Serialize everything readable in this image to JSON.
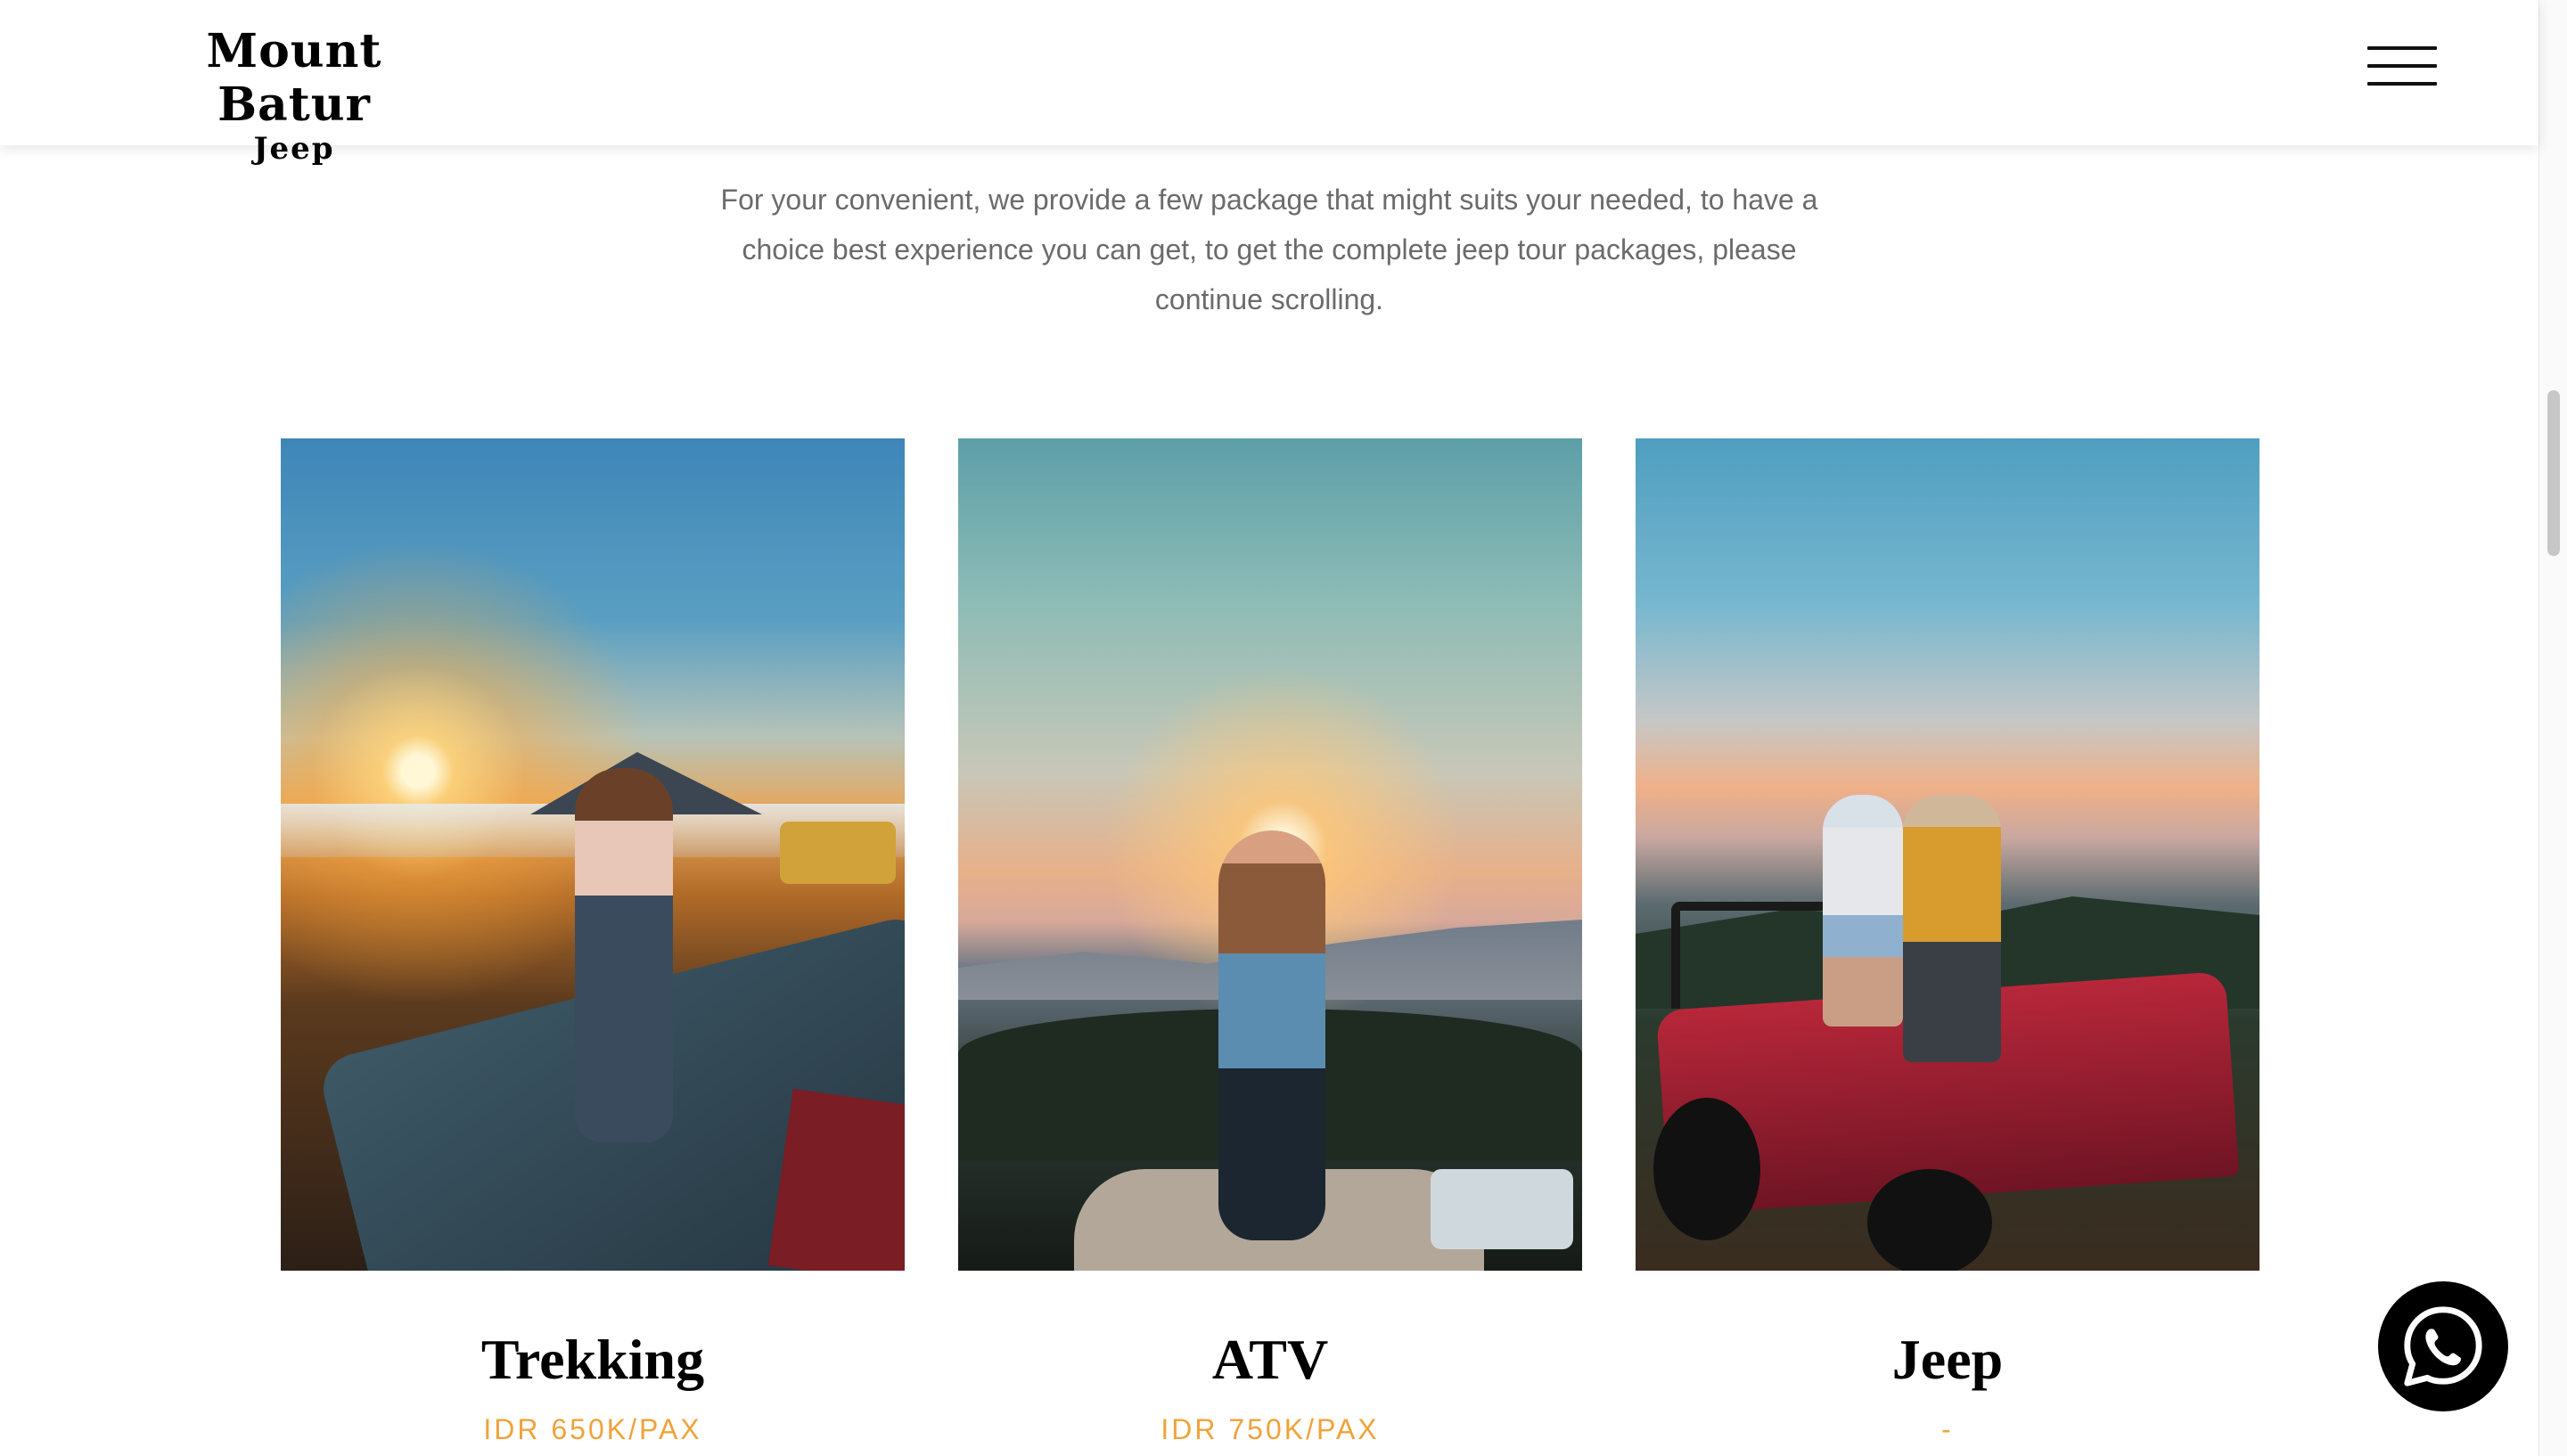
{
  "header": {
    "logo_title": "Mount Batur",
    "logo_subtitle": "Jeep",
    "menu_icon": "hamburger-icon"
  },
  "intro": {
    "text": "For your convenient, we provide a few package that might suits your needed, to have a choice best experience you can get, to get the complete jeep tour packages, please continue scrolling."
  },
  "packages": [
    {
      "title": "Trekking",
      "price": "IDR 650K/PAX"
    },
    {
      "title": "ATV",
      "price": "IDR 750K/PAX"
    },
    {
      "title": "Jeep",
      "price": "-"
    }
  ],
  "colors": {
    "price_accent": "#f0a23a",
    "text_muted": "#6b6b6b",
    "whatsapp_bg": "#000000"
  },
  "floating": {
    "whatsapp_icon": "whatsapp-icon"
  }
}
